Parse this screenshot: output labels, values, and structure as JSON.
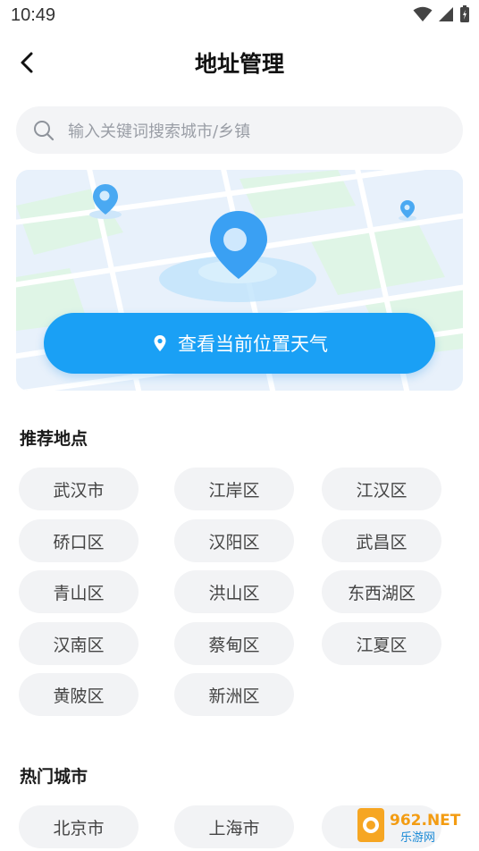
{
  "status_bar": {
    "time": "10:49"
  },
  "header": {
    "title": "地址管理"
  },
  "search": {
    "placeholder": "输入关键词搜索城市/乡镇"
  },
  "locate": {
    "label": "查看当前位置天气"
  },
  "recommended": {
    "title": "推荐地点",
    "items": [
      "武汉市",
      "江岸区",
      "江汉区",
      "硚口区",
      "汉阳区",
      "武昌区",
      "青山区",
      "洪山区",
      "东西湖区",
      "汉南区",
      "蔡甸区",
      "江夏区",
      "黄陂区",
      "新洲区"
    ]
  },
  "hot_cities": {
    "title": "热门城市",
    "items": [
      "北京市",
      "上海市"
    ]
  },
  "watermark": {
    "brand": "962.NET",
    "sub": "乐游网"
  },
  "colors": {
    "accent": "#1aa0f5",
    "chip_bg": "#f2f3f5",
    "search_bg": "#f3f4f6"
  }
}
